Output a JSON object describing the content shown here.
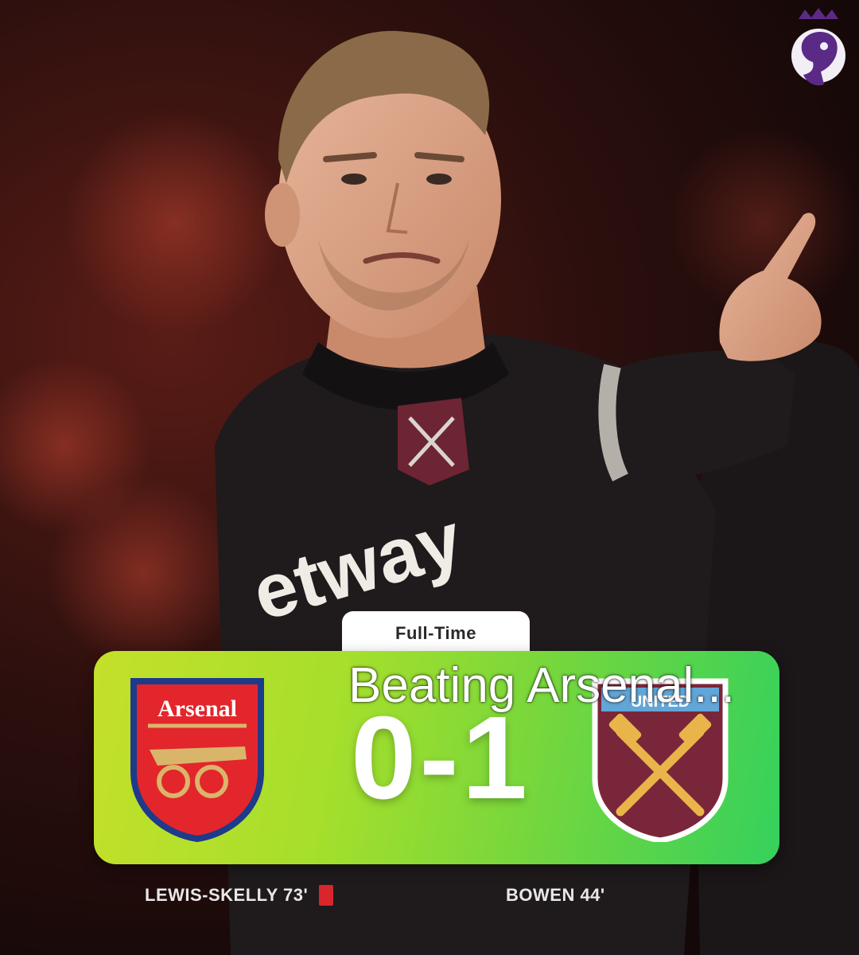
{
  "competition_logo": "premier-league-lion-logo",
  "player": {
    "shirt_sponsor": "etway"
  },
  "match": {
    "status": "Full-Time",
    "score": "0-1",
    "home_team": {
      "name": "Arsenal",
      "crest": "arsenal-crest",
      "color": "#e3262c"
    },
    "away_team": {
      "crest_text": "UNITED",
      "crest": "west-ham-crest",
      "color": "#7a263a"
    },
    "home_scorers": "LEWIS-SKELLY 73'",
    "away_scorers": "BOWEN 44'"
  },
  "caption": "Beating Arsenal...",
  "colors": {
    "bar_left": "#c4e02a",
    "bar_right": "#35d15c",
    "red_card": "#d8262c"
  }
}
